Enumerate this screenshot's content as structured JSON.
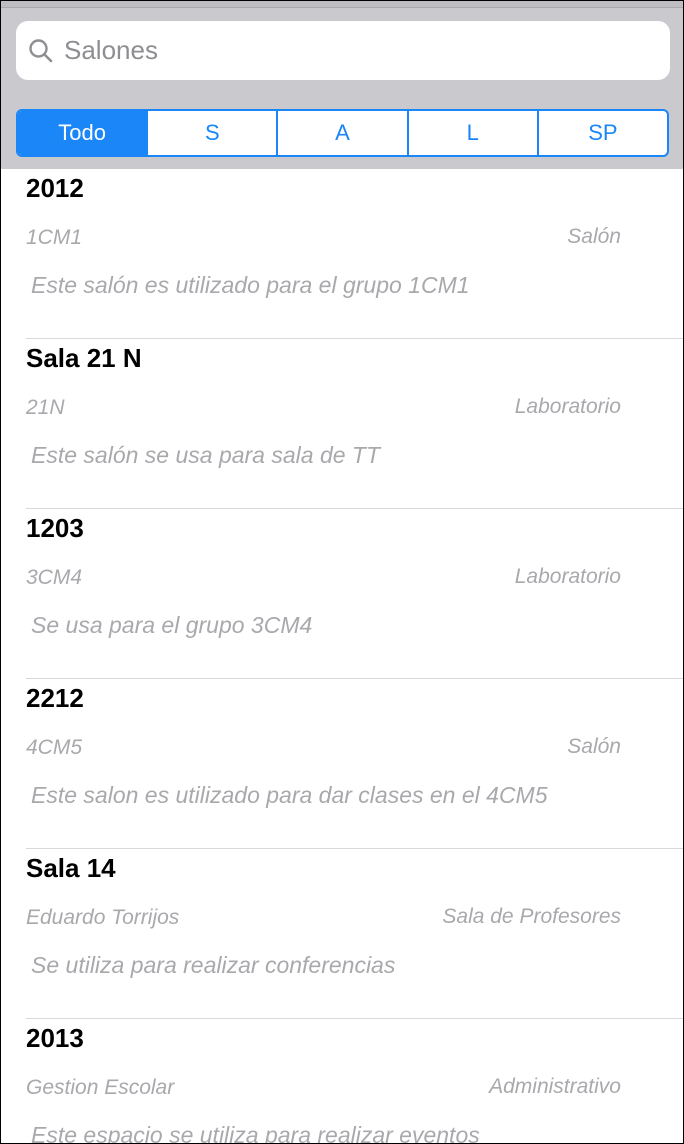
{
  "search": {
    "placeholder": "Salones",
    "icon": "search-icon"
  },
  "filter": {
    "segments": [
      "Todo",
      "S",
      "A",
      "L",
      "SP"
    ],
    "selected": "Todo",
    "accent": "#1a86f7"
  },
  "rooms": [
    {
      "title": "2012",
      "code": "1CM1",
      "type": "Salón",
      "description": "Este salón es utilizado para el grupo 1CM1"
    },
    {
      "title": "Sala 21 N",
      "code": "21N",
      "type": "Laboratorio",
      "description": "Este salón se usa para sala de TT"
    },
    {
      "title": "1203",
      "code": "3CM4",
      "type": "Laboratorio",
      "description": "Se usa para el grupo 3CM4"
    },
    {
      "title": "2212",
      "code": "4CM5",
      "type": "Salón",
      "description": "Este salon es utilizado para dar clases en el 4CM5"
    },
    {
      "title": "Sala  14",
      "code": "Eduardo Torrijos",
      "type": "Sala de Profesores",
      "description": "Se utiliza para realizar conferencias"
    },
    {
      "title": "2013",
      "code": "Gestion Escolar",
      "type": "Administrativo",
      "description": "Este espacio se utiliza para realizar eventos"
    }
  ]
}
